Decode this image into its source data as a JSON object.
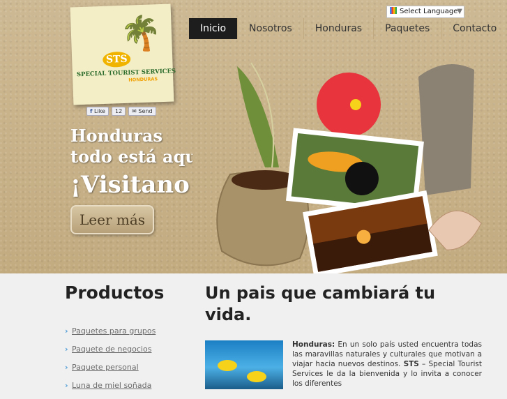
{
  "logo": {
    "badge": "STS",
    "name": "SPECIAL TOURIST SERVICES",
    "sub": "HONDURAS"
  },
  "social": {
    "like": "Like",
    "count": "12",
    "send": "Send"
  },
  "language": {
    "label": "Select Language",
    "arrow": "▼"
  },
  "nav": [
    "Inicio",
    "Nosotros",
    "Honduras",
    "Paquetes",
    "Contacto"
  ],
  "hero": {
    "line1": "Honduras",
    "line2": "todo está aqu",
    "line3": "¡Visitano",
    "button": "Leer más"
  },
  "sidebar": {
    "title": "Productos",
    "links": [
      "Paquetes para grupos",
      "Paquete de negocios",
      "Paquete personal",
      "Luna de miel soñada"
    ]
  },
  "main": {
    "title": "Un pais que cambiará tu vida.",
    "bold1": "Honduras:",
    "text1": " En un solo país usted encuentra todas las maravillas naturales y culturales que motivan a viajar hacia nuevos destinos. ",
    "bold2": "STS",
    "text2": " – Special Tourist Services le da la bienvenida y lo invita a conocer los diferentes"
  }
}
